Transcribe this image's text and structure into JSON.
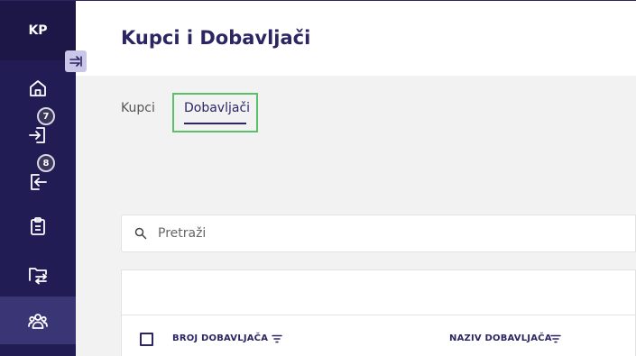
{
  "app": {
    "logo_text": "KP"
  },
  "sidebar": {
    "items": [
      {
        "icon": "home-icon",
        "badge": ""
      },
      {
        "icon": "inbox-arrow-icon",
        "badge": "7"
      },
      {
        "icon": "outbox-arrow-icon",
        "badge": "8"
      },
      {
        "icon": "clipboard-icon",
        "badge": ""
      },
      {
        "icon": "folder-transfer-icon",
        "badge": ""
      },
      {
        "icon": "users-icon",
        "badge": "",
        "active": true
      }
    ],
    "colors": {
      "background": "#221c54",
      "active": "#3a3575"
    }
  },
  "header": {
    "title": "Kupci i Dobavljači"
  },
  "tabs": [
    {
      "label": "Kupci",
      "active": false
    },
    {
      "label": "Dobavljači",
      "active": true
    }
  ],
  "search": {
    "placeholder": "Pretraži",
    "value": ""
  },
  "table": {
    "columns": [
      {
        "label": "BROJ DOBAVLJAČA"
      },
      {
        "label": "NAZIV DOBAVLJAČA"
      }
    ]
  },
  "colors": {
    "accent": "#2b2563",
    "highlight": "#5cbf6a"
  }
}
